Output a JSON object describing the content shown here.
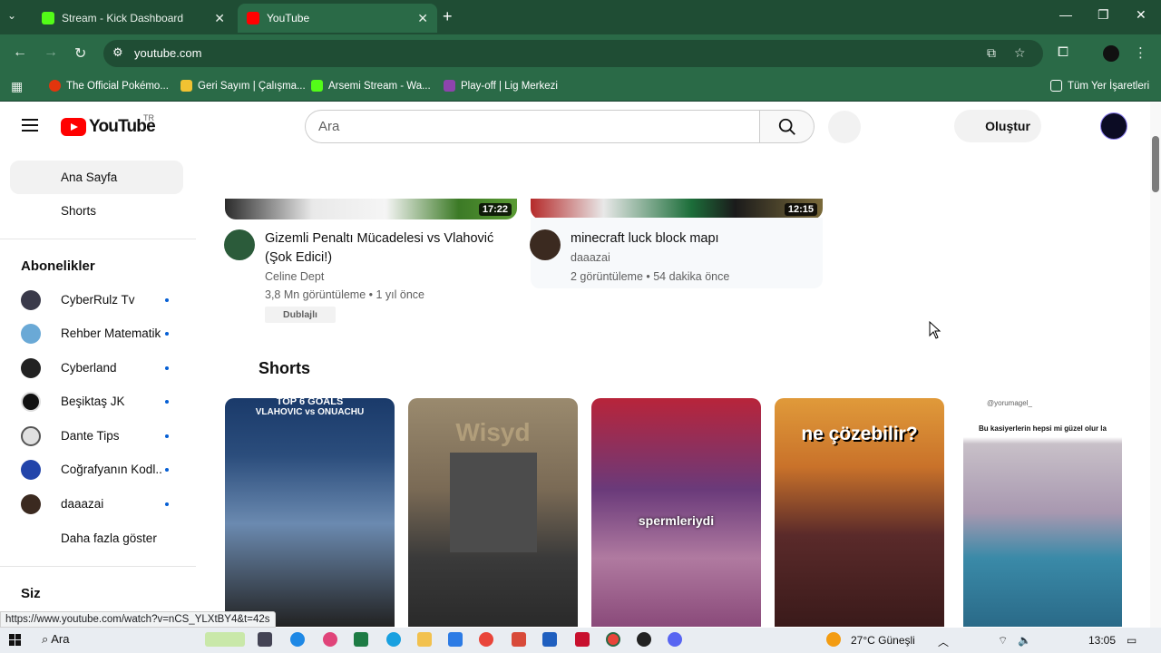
{
  "browser": {
    "tabs": [
      {
        "title": "Stream - Kick Dashboard",
        "favicon_color": "#53fc18"
      },
      {
        "title": "YouTube",
        "favicon_color": "#ff0000"
      }
    ],
    "new_tab_label": "+",
    "url": "youtube.com",
    "bookmarks": [
      {
        "label": "The Official Pokémo...",
        "icon_color": "#e3350d"
      },
      {
        "label": "Geri Sayım | Çalışma...",
        "icon_color": "#f1c232"
      },
      {
        "label": "Arsemi Stream - Wa...",
        "icon_color": "#53fc18"
      },
      {
        "label": "Play-off | Lig Merkezi",
        "icon_color": "#8e44ad"
      }
    ],
    "all_bookmarks_label": "Tüm Yer İşaretleri",
    "status_url": "https://www.youtube.com/watch?v=nCS_YLXtBY4&t=42s"
  },
  "youtube": {
    "logo_text": "YouTube",
    "country_code": "TR",
    "search": {
      "placeholder": "Ara"
    },
    "create_label": "Oluştur",
    "sidebar": {
      "main": [
        {
          "label": "Ana Sayfa",
          "selected": true
        },
        {
          "label": "Shorts",
          "selected": false
        }
      ],
      "subscriptions_title": "Abonelikler",
      "subscriptions": [
        {
          "name": "CyberRulz Tv",
          "avatar_color": "#3a3a4a"
        },
        {
          "name": "Rehber Matematik",
          "avatar_color": "#6aa9d6"
        },
        {
          "name": "Cyberland",
          "avatar_color": "#222222"
        },
        {
          "name": "Beşiktaş JK",
          "avatar_color": "#111111"
        },
        {
          "name": "Dante Tips",
          "avatar_color": "#e0e0e0"
        },
        {
          "name": "Coğrafyanın Kodl...",
          "avatar_color": "#2244aa"
        },
        {
          "name": "daaazai",
          "avatar_color": "#3b2a20"
        }
      ],
      "show_more": "Daha fazla göster",
      "you_title": "Siz"
    },
    "videos": [
      {
        "duration": "17:22",
        "title": "Gizemli Penaltı Mücadelesi vs Vlahović (Şok Edici!)",
        "channel": "Celine Dept",
        "meta": "3,8 Mn görüntüleme • 1 yıl önce",
        "badge": "Dublajlı"
      },
      {
        "duration": "12:15",
        "title": "minecraft luck block mapı",
        "channel": "daaazai",
        "meta": "2 görüntüleme • 54 dakika önce"
      }
    ],
    "shorts_title": "Shorts",
    "shorts": [
      {
        "caption_top": "TOP 6 GOALS",
        "caption_sub": "VLAHOVIC vs ONUACHU"
      },
      {
        "caption": "Wisyd"
      },
      {
        "caption": "spermleriydi"
      },
      {
        "caption": "ne çözebilir?"
      },
      {
        "caption_top": "Bu kasiyerlerin hepsi mi güzel olur la",
        "handle": "@yorumagel_"
      }
    ]
  },
  "taskbar": {
    "search_label": "Ara",
    "weather": "27°C  Güneşli",
    "time": "13:05"
  }
}
